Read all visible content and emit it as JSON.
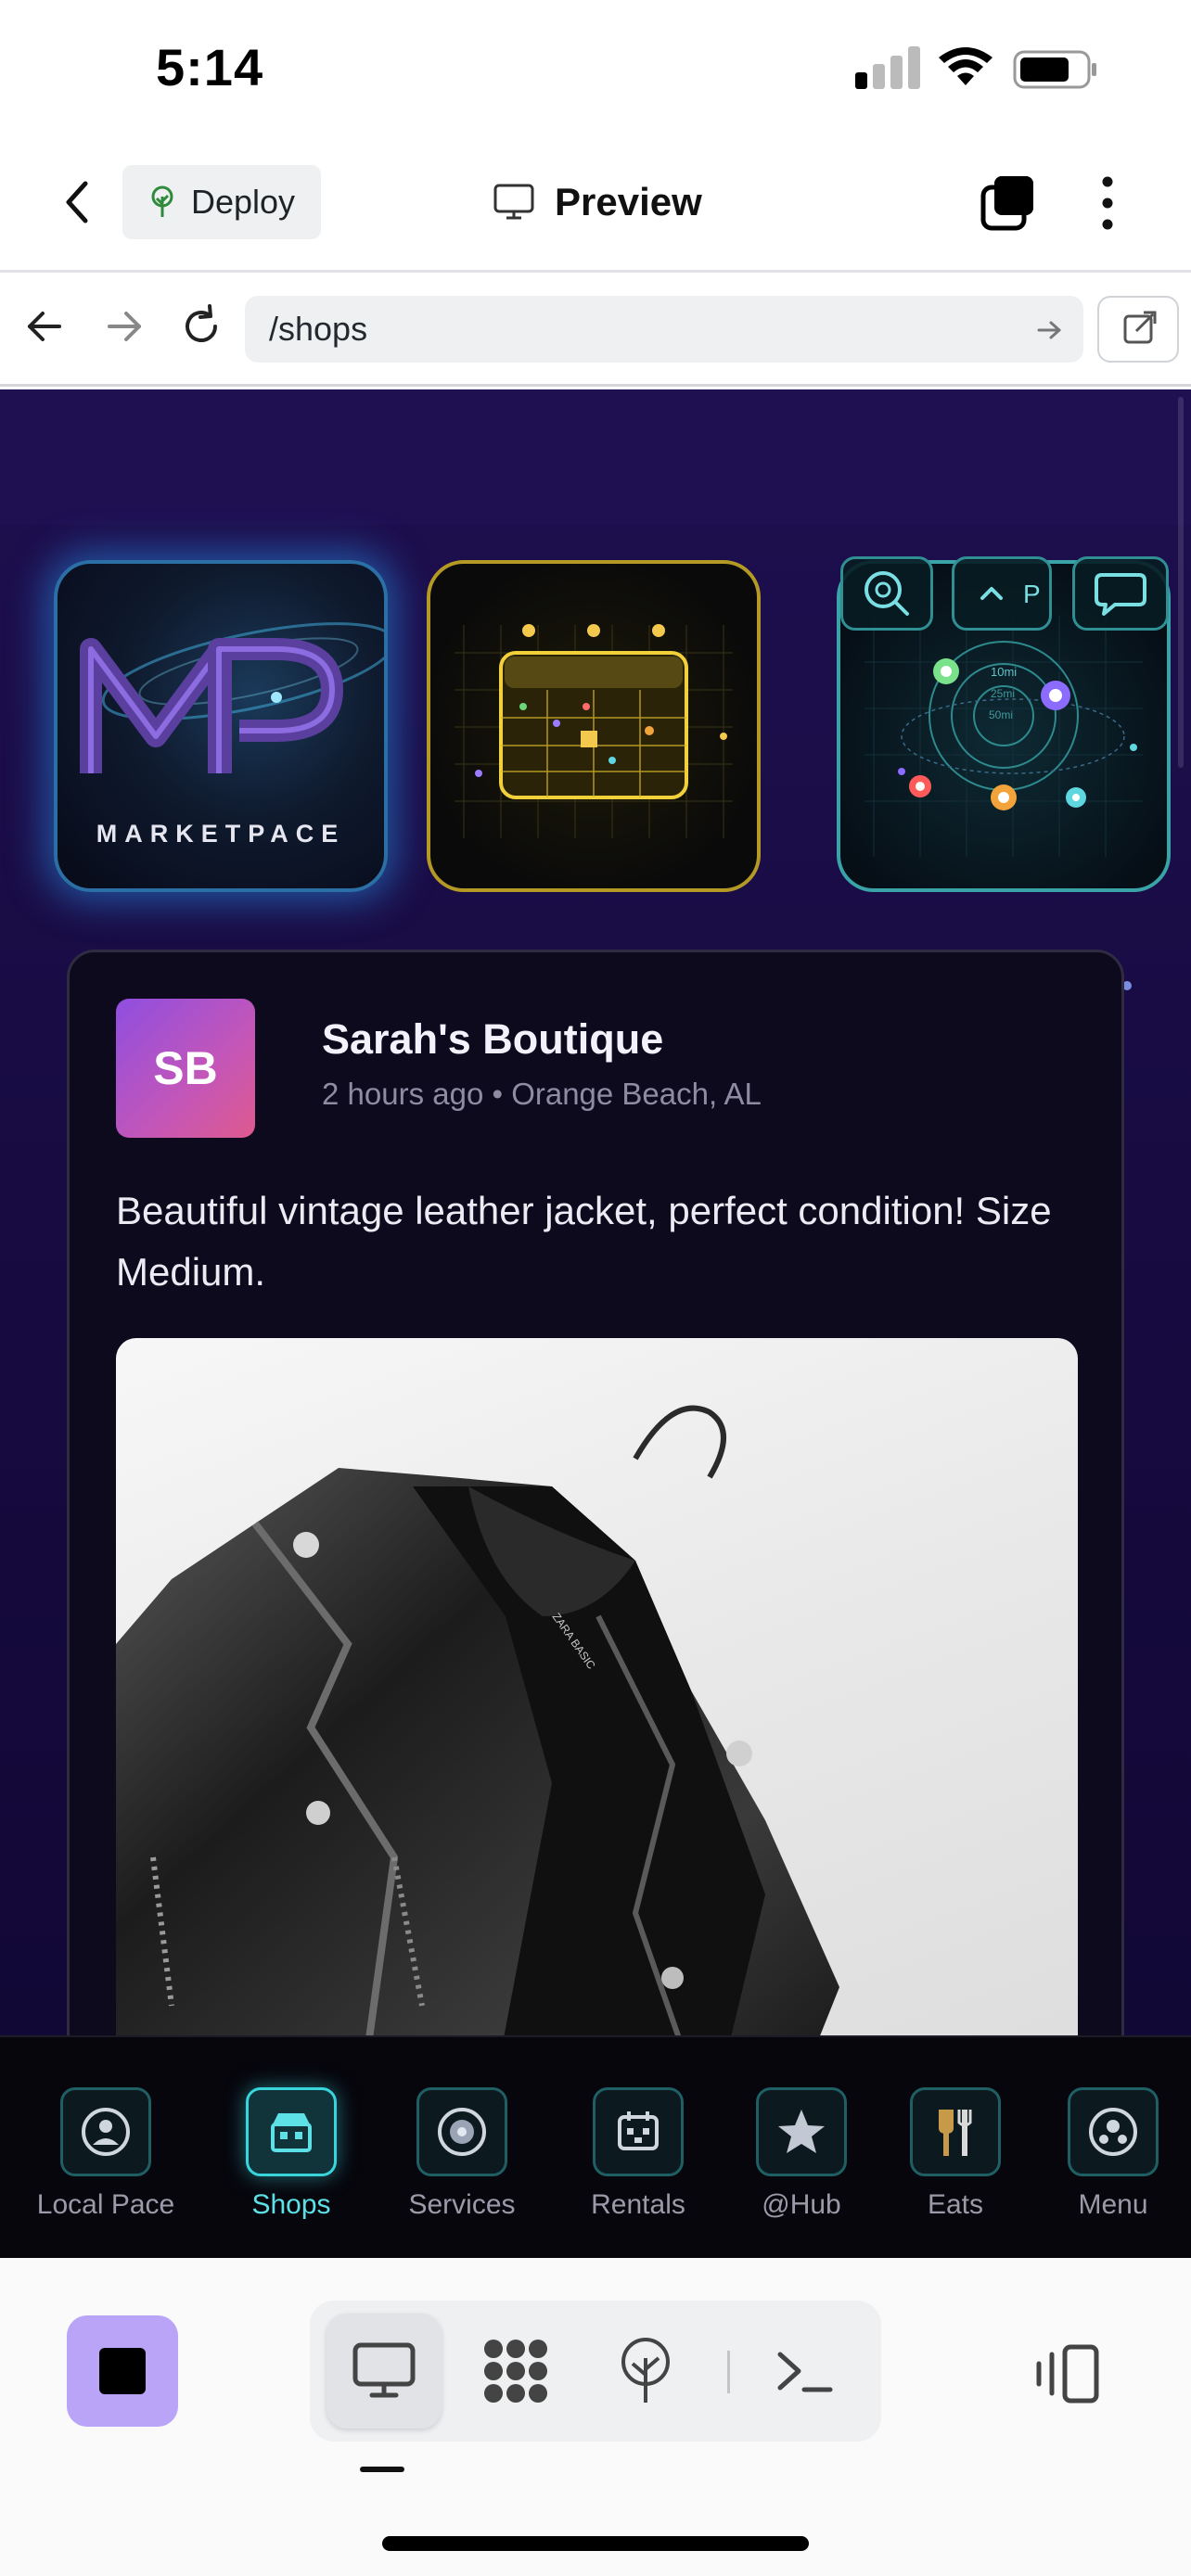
{
  "status_bar": {
    "time": "5:14",
    "signal_icon": "signal-icon",
    "wifi_icon": "wifi-icon",
    "battery_icon": "battery-icon"
  },
  "header": {
    "back_icon": "chevron-left-icon",
    "deploy_label": "Deploy",
    "deploy_icon": "tree-icon",
    "preview_label": "Preview",
    "preview_icon": "monitor-icon",
    "tabs_icon": "tabs-icon",
    "more_icon": "more-vertical-icon"
  },
  "browser": {
    "back_icon": "arrow-left-icon",
    "forward_icon": "arrow-right-icon",
    "reload_icon": "reload-icon",
    "url": "/shops",
    "go_icon": "arrow-right-icon",
    "open_external_icon": "external-link-icon"
  },
  "tiles": [
    {
      "name": "marketpace-logo",
      "brand": "MARKETPACE",
      "accent": "#2a6fa5"
    },
    {
      "name": "calendar-tile",
      "accent": "#b49a25"
    },
    {
      "name": "radar-tile",
      "accent": "#3aa3a8",
      "rings": [
        "10mi",
        "25mi",
        "50mi"
      ],
      "button_p": "P"
    }
  ],
  "post": {
    "initials": "SB",
    "shop_name": "Sarah's Boutique",
    "meta": "2 hours ago • Orange Beach, AL",
    "text": "Beautiful vintage leather jacket, perfect condition! Size Medium.",
    "photo_label": "ZARA BASIC"
  },
  "app_nav": {
    "items": [
      {
        "label": "Local Pace",
        "icon": "local-pace-icon",
        "active": false
      },
      {
        "label": "Shops",
        "icon": "shops-icon",
        "active": true
      },
      {
        "label": "Services",
        "icon": "services-icon",
        "active": false
      },
      {
        "label": "Rentals",
        "icon": "rentals-icon",
        "active": false
      },
      {
        "label": "@Hub",
        "icon": "star-icon",
        "active": false
      },
      {
        "label": "Eats",
        "icon": "fork-knife-icon",
        "active": false
      },
      {
        "label": "Menu",
        "icon": "menu-icon",
        "active": false
      }
    ],
    "active_color": "#5de1e7"
  },
  "toolbar": {
    "stop_icon": "stop-icon",
    "preview_icon": "monitor-icon",
    "apps_icon": "apps-icon",
    "deploy_icon": "tree-icon",
    "console_icon": "terminal-icon",
    "layout_icon": "layout-icon",
    "accent": "#b9a4f7"
  }
}
